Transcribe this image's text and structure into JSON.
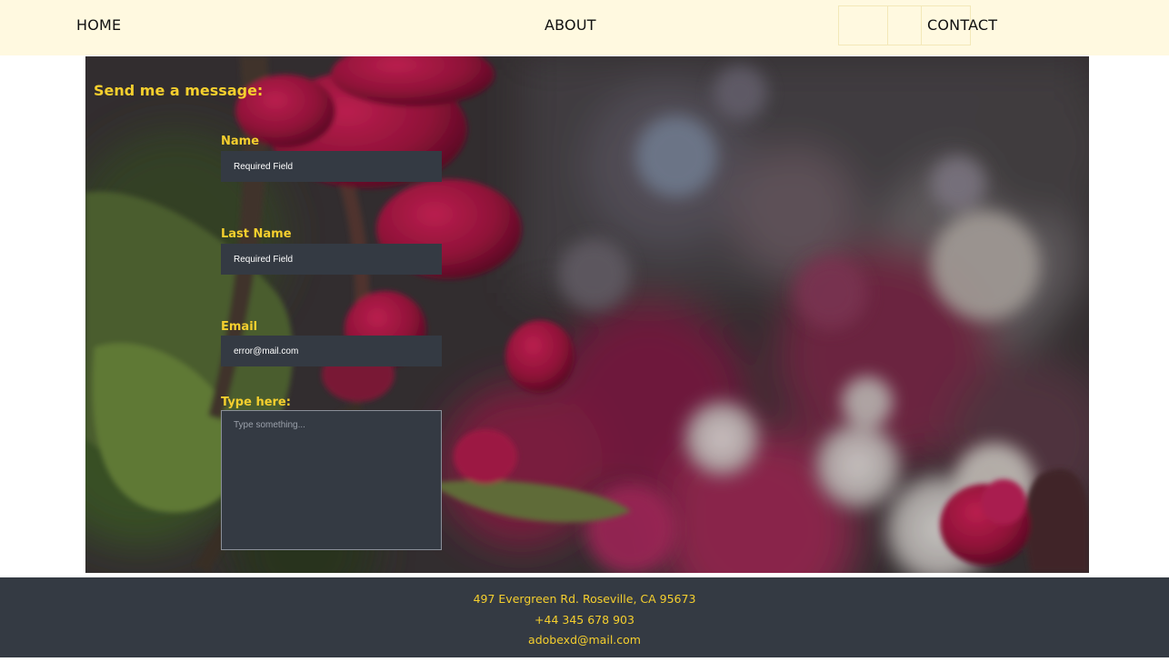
{
  "nav": {
    "home": "HOME",
    "about": "ABOUT",
    "contact": "CONTACT"
  },
  "form": {
    "title": "Send me a message:",
    "name_label": "Name",
    "name_placeholder": "Required Field",
    "lastname_label": "Last Name",
    "lastname_placeholder": "Required Field",
    "email_label": "Email",
    "email_value": "error@mail.com",
    "message_label": "Type here:",
    "message_placeholder": "Type something..."
  },
  "footer": {
    "address": "497 Evergreen Rd. Roseville, CA 95673",
    "phone": "+44 345 678 903",
    "email": "adobexd@mail.com"
  },
  "colors": {
    "nav_bg": "#fff9e0",
    "accent": "#f5cf2e",
    "field_bg": "#343a43",
    "footer_bg": "#343a43"
  }
}
